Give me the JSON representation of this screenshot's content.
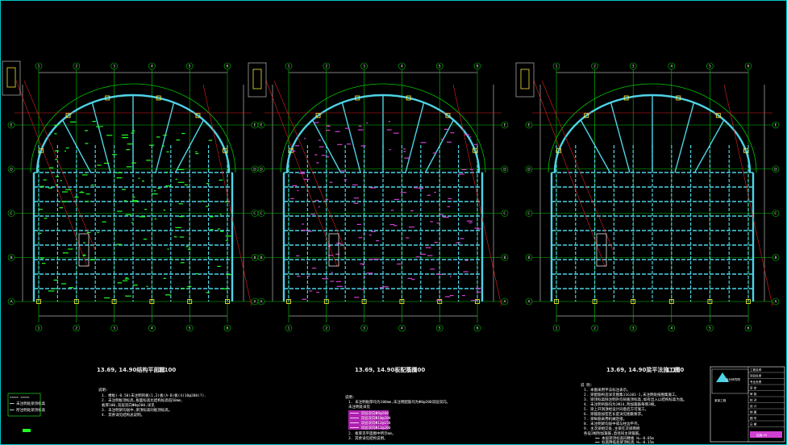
{
  "drawing": {
    "colors": {
      "background": "#000000",
      "frame": "#00c8c8",
      "axis_line": "#00c800",
      "dimension": "#ffffff",
      "beam": "#4fd3e6",
      "column": "#f2e23a",
      "section_line": "#e02020",
      "rebar": "#d040d0",
      "annotation": "#22ff22"
    },
    "plans": [
      {
        "title": "13.69, 14.90结构平面图",
        "scale": "1:100",
        "notes_heading": "说明:",
        "notes": [
          "1. 楼板(-0.50)未注明的板(1,2)板(A-B)板(4)10@200(?).",
          "2. 未注明板顶标高,板面标高比结构标高低50mm,",
          "   板厚100,双层双向Φ8@200,详见",
          "3. 未注明梁均居中,梁顶标高同板顶标高。",
          "4. 其余详见结构总说明。"
        ],
        "legend": [
          "≈≈≈≈  ≈≈≈≈",
          "━━ 未注明处梁顶标高",
          "━━ 所注明处梁顶标高"
        ],
        "axis_h": [
          "1",
          "2",
          "3",
          "4",
          "5",
          "6"
        ],
        "axis_v": [
          "A",
          "B",
          "C",
          "D",
          "E"
        ]
      },
      {
        "title": "13.69, 14.90板配筋图",
        "scale": "1:100",
        "notes_heading": "说明:",
        "notes": [
          "1. 未注明板厚均为100mm,未注明配筋均为Φ8@200双层双向。",
          "   未注明处详见"
        ],
        "legend": [
          "━━━━  双层双向Φ8@200",
          "━━━━  双层双向Φ10@200",
          "━━━━  双层双向Φ12@150",
          "━━━━  双层双向Φ12@200",
          "2. 板厚见平面图中所示mm。",
          "3. 其余详见结构说明。"
        ],
        "axis_h": [
          "1",
          "2",
          "3",
          "4",
          "5",
          "6"
        ],
        "axis_v": [
          "A",
          "B",
          "C",
          "D",
          "E"
        ]
      },
      {
        "title": "13.69, 14.90梁平法施工图",
        "scale": "1:100",
        "notes_heading": "说 明:",
        "notes": [
          "1. 本图采用平法标注表示。",
          "2. 梁配筋构造详见图集11G101-1,未注明处按图集施工。",
          "3. 梁顶标高除注明外均同板顶标高,如有出入以结构标高为准。",
          "4. 未注明吊筋均为2Φ14,附加箍筋每侧3根。",
          "5. 梁上开洞须经设计同意后方可施工。",
          "6. 梁箍筋加密区长度详见图集要求。",
          "7. 梁纵筋采用机械连接。",
          "8. 未注明梁均居中或与柱边平齐。",
          "9. 主次梁相交处,主梁在次梁两侧",
          "   各设3根附加箍筋,直径同主梁箍筋。"
        ],
        "legend": [
          "━━ 本层梁顶标高同楼板 H=-0.05m",
          "━━ 标高降低处梁顶标高 H=-0.15m"
        ],
        "axis_h": [
          "1",
          "2",
          "3",
          "4",
          "5",
          "6"
        ],
        "axis_v": [
          "A",
          "B",
          "C",
          "D",
          "E"
        ]
      }
    ],
    "title_block": {
      "company": "设计研究院",
      "project": "某某工程",
      "rows": [
        "工程名称",
        "项目负责",
        "专业负责",
        "审 定",
        "审 核",
        "校 对",
        "设 计",
        "制 图",
        "图 号",
        "日 期"
      ],
      "sheet": "结施-09"
    }
  }
}
